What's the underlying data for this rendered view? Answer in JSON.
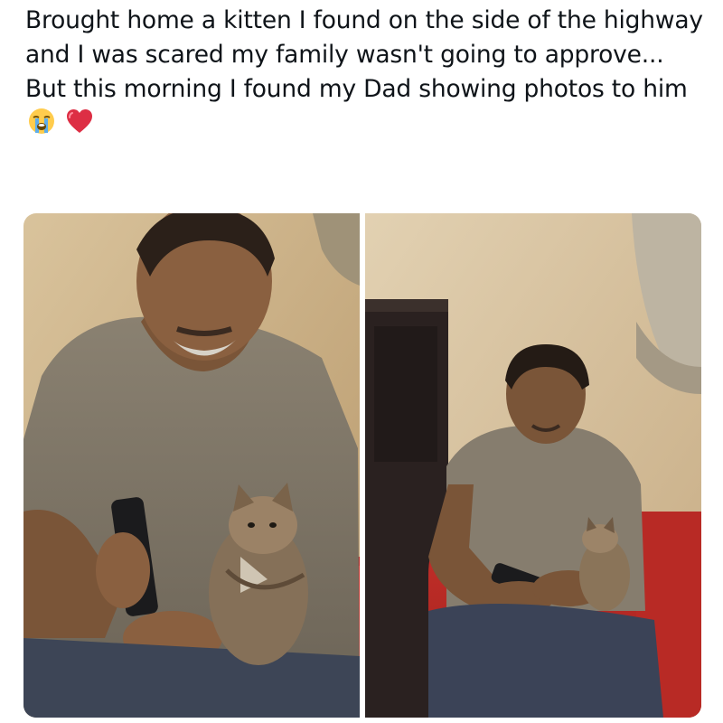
{
  "post": {
    "caption_text": "Brought home a kitten I found on the side of the highway and I was scared my family wasn't going to approve... But this morning I found my Dad showing photos to him",
    "emojis": [
      "loudly-crying-face-icon",
      "red-heart-icon"
    ]
  },
  "media": {
    "image_count": 2,
    "images": [
      {
        "depiction": "dad-holding-phone-showing-kitten"
      },
      {
        "depiction": "dad-on-red-chair-with-kitten"
      }
    ]
  }
}
